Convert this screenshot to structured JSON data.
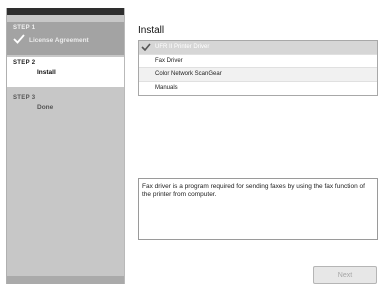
{
  "sidebar": {
    "steps": [
      {
        "tag": "STEP 1",
        "label": "License Agreement",
        "state": "done"
      },
      {
        "tag": "STEP 2",
        "label": "Install",
        "state": "current"
      },
      {
        "tag": "STEP 3",
        "label": "Done",
        "state": "pending"
      }
    ]
  },
  "main": {
    "title": "Install",
    "drivers": [
      {
        "label": "UFR II Printer Driver",
        "checked": true
      },
      {
        "label": "Fax Driver",
        "checked": false
      },
      {
        "label": "Color Network ScanGear",
        "checked": false
      },
      {
        "label": "Manuals",
        "checked": false
      }
    ],
    "description": "Fax driver is a program required for sending faxes by using the fax function of the printer from computer."
  },
  "footer": {
    "next_label": "Next"
  },
  "colors": {
    "sidebar_bg": "#c7c7c7",
    "active_step_bg": "#ffffff",
    "done_step_bg": "#a3a3a3"
  },
  "icons": {
    "step_done": "check-icon",
    "driver_checked": "check-icon"
  }
}
